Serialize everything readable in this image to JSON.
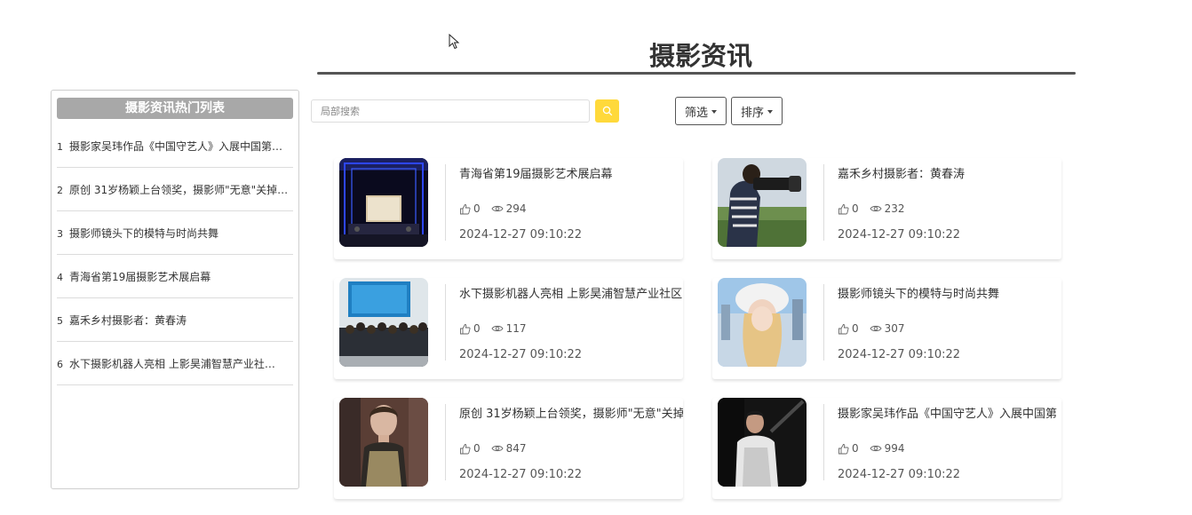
{
  "page": {
    "title": "摄影资讯"
  },
  "sidebar": {
    "header": "摄影资讯热门列表",
    "items": [
      {
        "num": "1",
        "label": "摄影家吴玮作品《中国守艺人》入展中国第…"
      },
      {
        "num": "2",
        "label": "原创 31岁杨颖上台领奖，摄影师\"无意\"关掉…"
      },
      {
        "num": "3",
        "label": "摄影师镜头下的模特与时尚共舞"
      },
      {
        "num": "4",
        "label": "青海省第19届摄影艺术展启幕"
      },
      {
        "num": "5",
        "label": "嘉禾乡村摄影者：黄春涛"
      },
      {
        "num": "6",
        "label": "水下摄影机器人亮相 上影昊浦智慧产业社…"
      }
    ]
  },
  "search": {
    "placeholder": "局部搜索",
    "value": ""
  },
  "toolbar": {
    "filter_label": "筛选",
    "sort_label": "排序"
  },
  "colors": {
    "accent": "#ffd93b",
    "sidebar_header": "#a8a8a8",
    "rule": "#555555"
  },
  "cards": [
    {
      "title": "青海省第19届摄影艺术展启幕",
      "likes": "0",
      "views": "294",
      "date": "2024-12-27 09:10:22",
      "thumb": "stage-hall"
    },
    {
      "title": "嘉禾乡村摄影者：黄春涛",
      "likes": "0",
      "views": "232",
      "date": "2024-12-27 09:10:22",
      "thumb": "photographer"
    },
    {
      "title": "水下摄影机器人亮相 上影昊浦智慧产业社区",
      "likes": "0",
      "views": "117",
      "date": "2024-12-27 09:10:22",
      "thumb": "group-photo"
    },
    {
      "title": "摄影师镜头下的模特与时尚共舞",
      "likes": "0",
      "views": "307",
      "date": "2024-12-27 09:10:22",
      "thumb": "model"
    },
    {
      "title": "原创 31岁杨颖上台领奖，摄影师\"无意\"关掉",
      "likes": "0",
      "views": "847",
      "date": "2024-12-27 09:10:22",
      "thumb": "award"
    },
    {
      "title": "摄影家吴玮作品《中国守艺人》入展中国第",
      "likes": "0",
      "views": "994",
      "date": "2024-12-27 09:10:22",
      "thumb": "artisan"
    }
  ]
}
